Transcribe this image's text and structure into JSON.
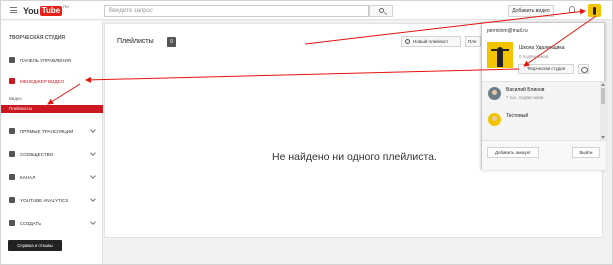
{
  "header": {
    "logo_you": "You",
    "logo_tube": "Tube",
    "logo_region": "RU",
    "search_placeholder": "Введите запрос",
    "add_video_label": "Добавить видео"
  },
  "sidebar": {
    "studio_title": "ТВОРЧЕСКАЯ СТУДИЯ",
    "items": [
      {
        "label": "ПАНЕЛЬ УПРАВЛЕНИЯ",
        "icon": "dashboard-icon"
      },
      {
        "label": "МЕНЕДЖЕР ВИДЕО",
        "icon": "video-manager-icon"
      },
      {
        "label": "ПРЯМЫЕ ТРАНСЛЯЦИИ",
        "icon": "live-icon"
      },
      {
        "label": "СООБЩЕСТВО",
        "icon": "community-icon"
      },
      {
        "label": "КАНАЛ",
        "icon": "channel-icon"
      },
      {
        "label": "YOUTUBE ANALYTICS",
        "icon": "analytics-icon"
      },
      {
        "label": "СОЗДАТЬ",
        "icon": "create-icon"
      }
    ],
    "subitems": [
      {
        "label": "Видео"
      },
      {
        "label": "Плейлисты"
      }
    ],
    "feedback_label": "Справка и отзывы"
  },
  "main": {
    "title": "Плейлисты",
    "count": "0",
    "new_playlist_label": "Новый плейлист",
    "sort_label": "Пле",
    "empty_message": "Не найдено ни одного плейлиста."
  },
  "account_popup": {
    "email": "permiinm@mail.ru",
    "channel_name": "Школа Удаленщика",
    "channel_subs": "0 подписчиков",
    "studio_button": "Творческая студия",
    "accounts": [
      {
        "name": "Василий Блинов",
        "subs": "7 тыс. подписчиков"
      },
      {
        "name": "Тестовый",
        "subs": ""
      }
    ],
    "add_account_label": "Добавить аккаунт",
    "logout_label": "Выйти"
  },
  "colors": {
    "brand_red": "#e62117",
    "active_red": "#cc181e",
    "annotation_red": "#e8120c"
  }
}
